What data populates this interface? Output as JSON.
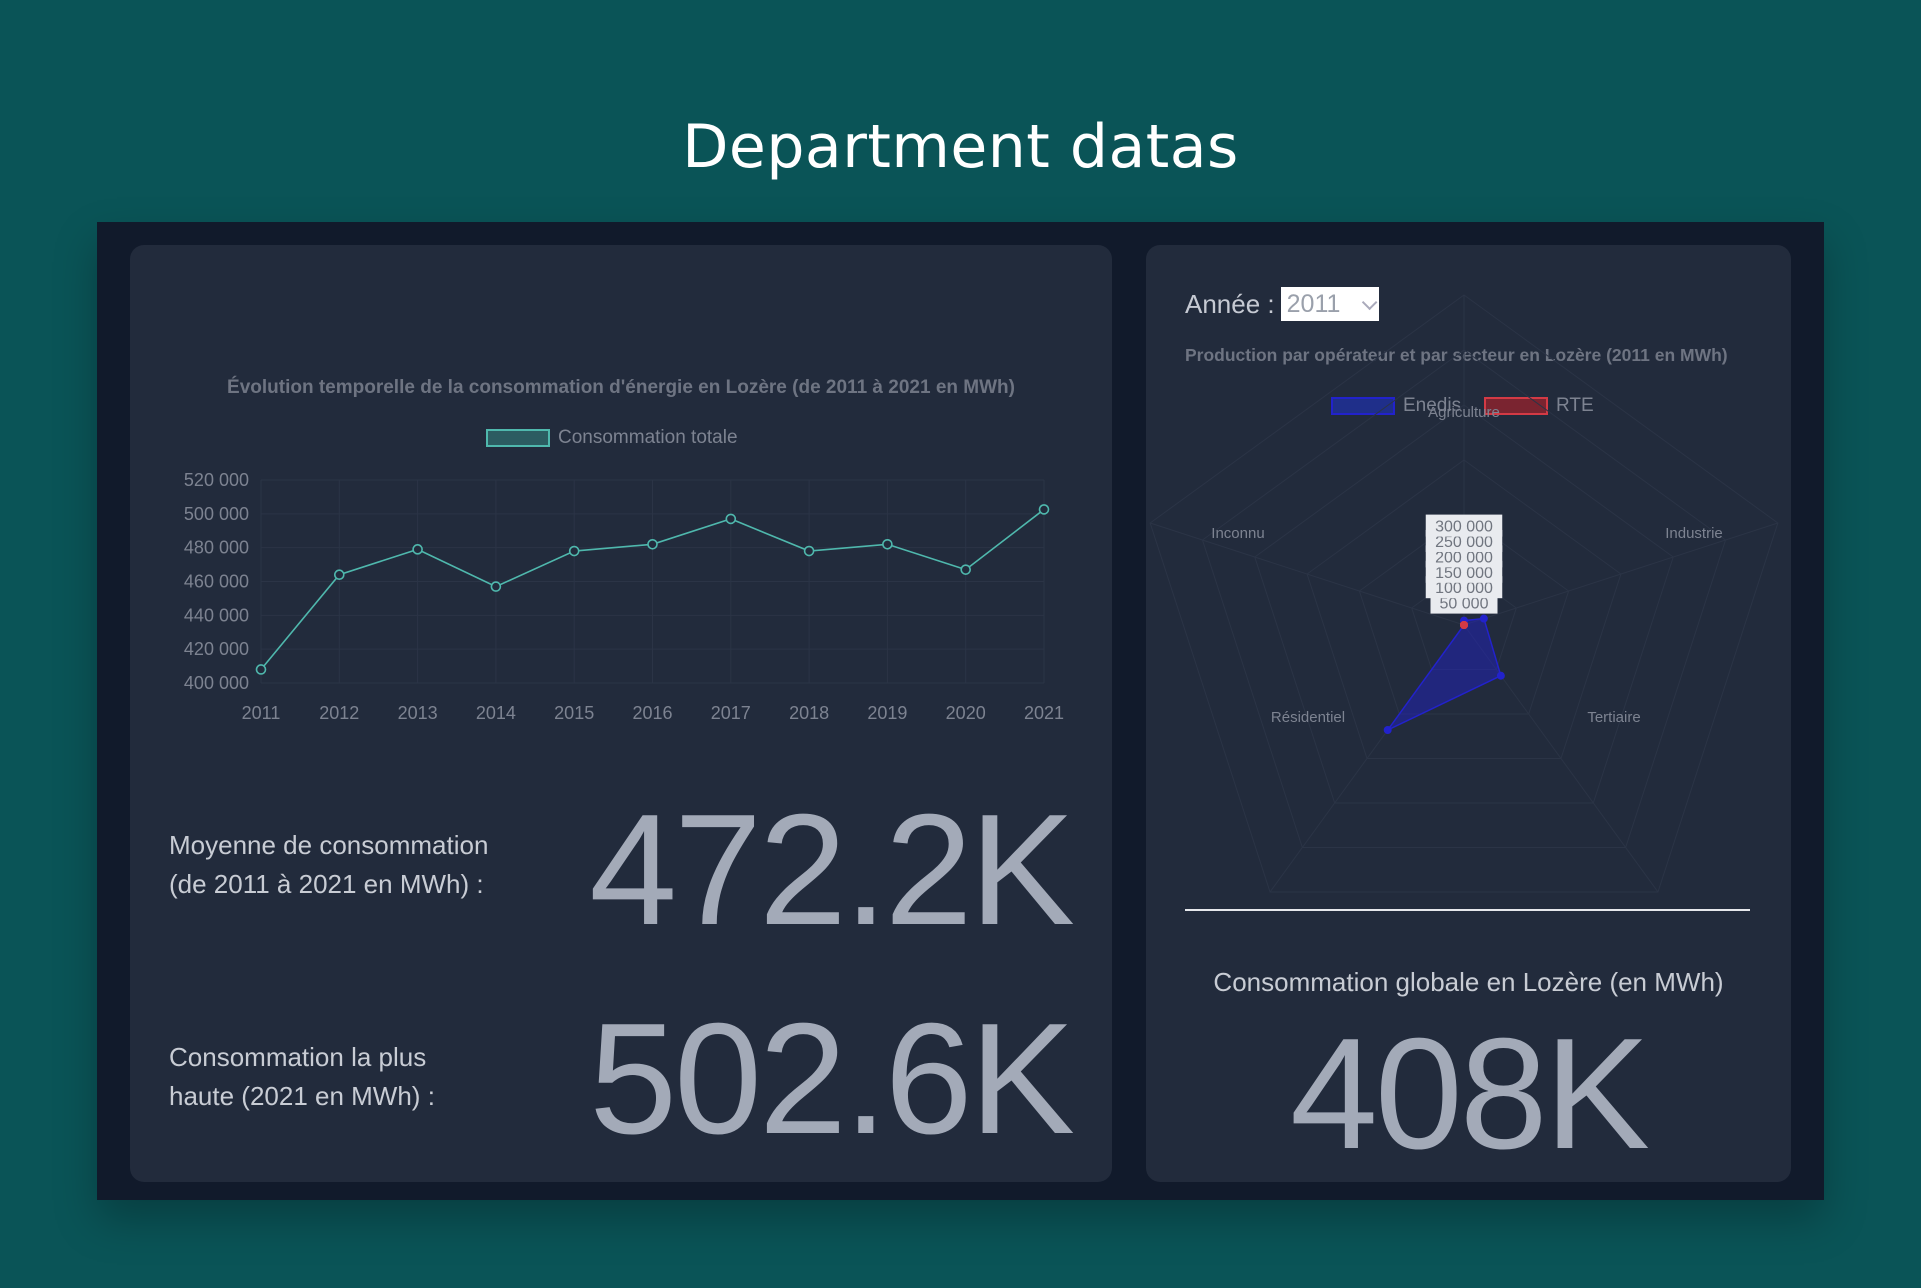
{
  "page": {
    "title": "Department datas"
  },
  "left": {
    "kpis": [
      {
        "label_line1": "Moyenne de consommation",
        "label_line2": "(de 2011 à 2021 en MWh) :",
        "value": "472.2K"
      },
      {
        "label_line1": "Consommation la plus",
        "label_line2": "haute (2021 en MWh) :",
        "value": "502.6K"
      }
    ]
  },
  "right": {
    "year_label": "Année :",
    "year_selected": "2011",
    "global_label": "Consommation globale en Lozère (en MWh)",
    "global_value": "408K"
  },
  "colors": {
    "background": "#0a5457",
    "panel": "#111a2b",
    "card": "#222b3c",
    "line": "#4fb8ad",
    "enedis": "#2222cc",
    "rte": "#d33a45"
  },
  "chart_data": [
    {
      "type": "line",
      "title": "Évolution temporelle de la consommation d'énergie en Lozère (de 2011 à 2021 en MWh)",
      "x": [
        "2011",
        "2012",
        "2013",
        "2014",
        "2015",
        "2016",
        "2017",
        "2018",
        "2019",
        "2020",
        "2021"
      ],
      "series": [
        {
          "name": "Consommation totale",
          "values": [
            408000,
            464000,
            479000,
            457000,
            478000,
            482000,
            497000,
            478000,
            482000,
            467000,
            502600
          ]
        }
      ],
      "ylim": [
        400000,
        520000
      ],
      "yticks": [
        "400 000",
        "420 000",
        "440 000",
        "460 000",
        "480 000",
        "500 000",
        "520 000"
      ],
      "grid": true,
      "legend_position": "top"
    },
    {
      "type": "radar",
      "title": "Production par opérateur et par secteur en Lozère (2011 en MWh)",
      "categories": [
        "Agriculture",
        "Industrie",
        "Tertiaire",
        "Résidentiel",
        "Inconnu"
      ],
      "series": [
        {
          "name": "Enedis",
          "values": [
            4000,
            19000,
            57000,
            118000,
            0
          ]
        },
        {
          "name": "RTE",
          "values": [
            0,
            0,
            0,
            0,
            0
          ]
        }
      ],
      "rlim": [
        0,
        300000
      ],
      "rticks": [
        "50 000",
        "100 000",
        "150 000",
        "200 000",
        "250 000",
        "300 000"
      ],
      "legend_position": "top"
    }
  ]
}
